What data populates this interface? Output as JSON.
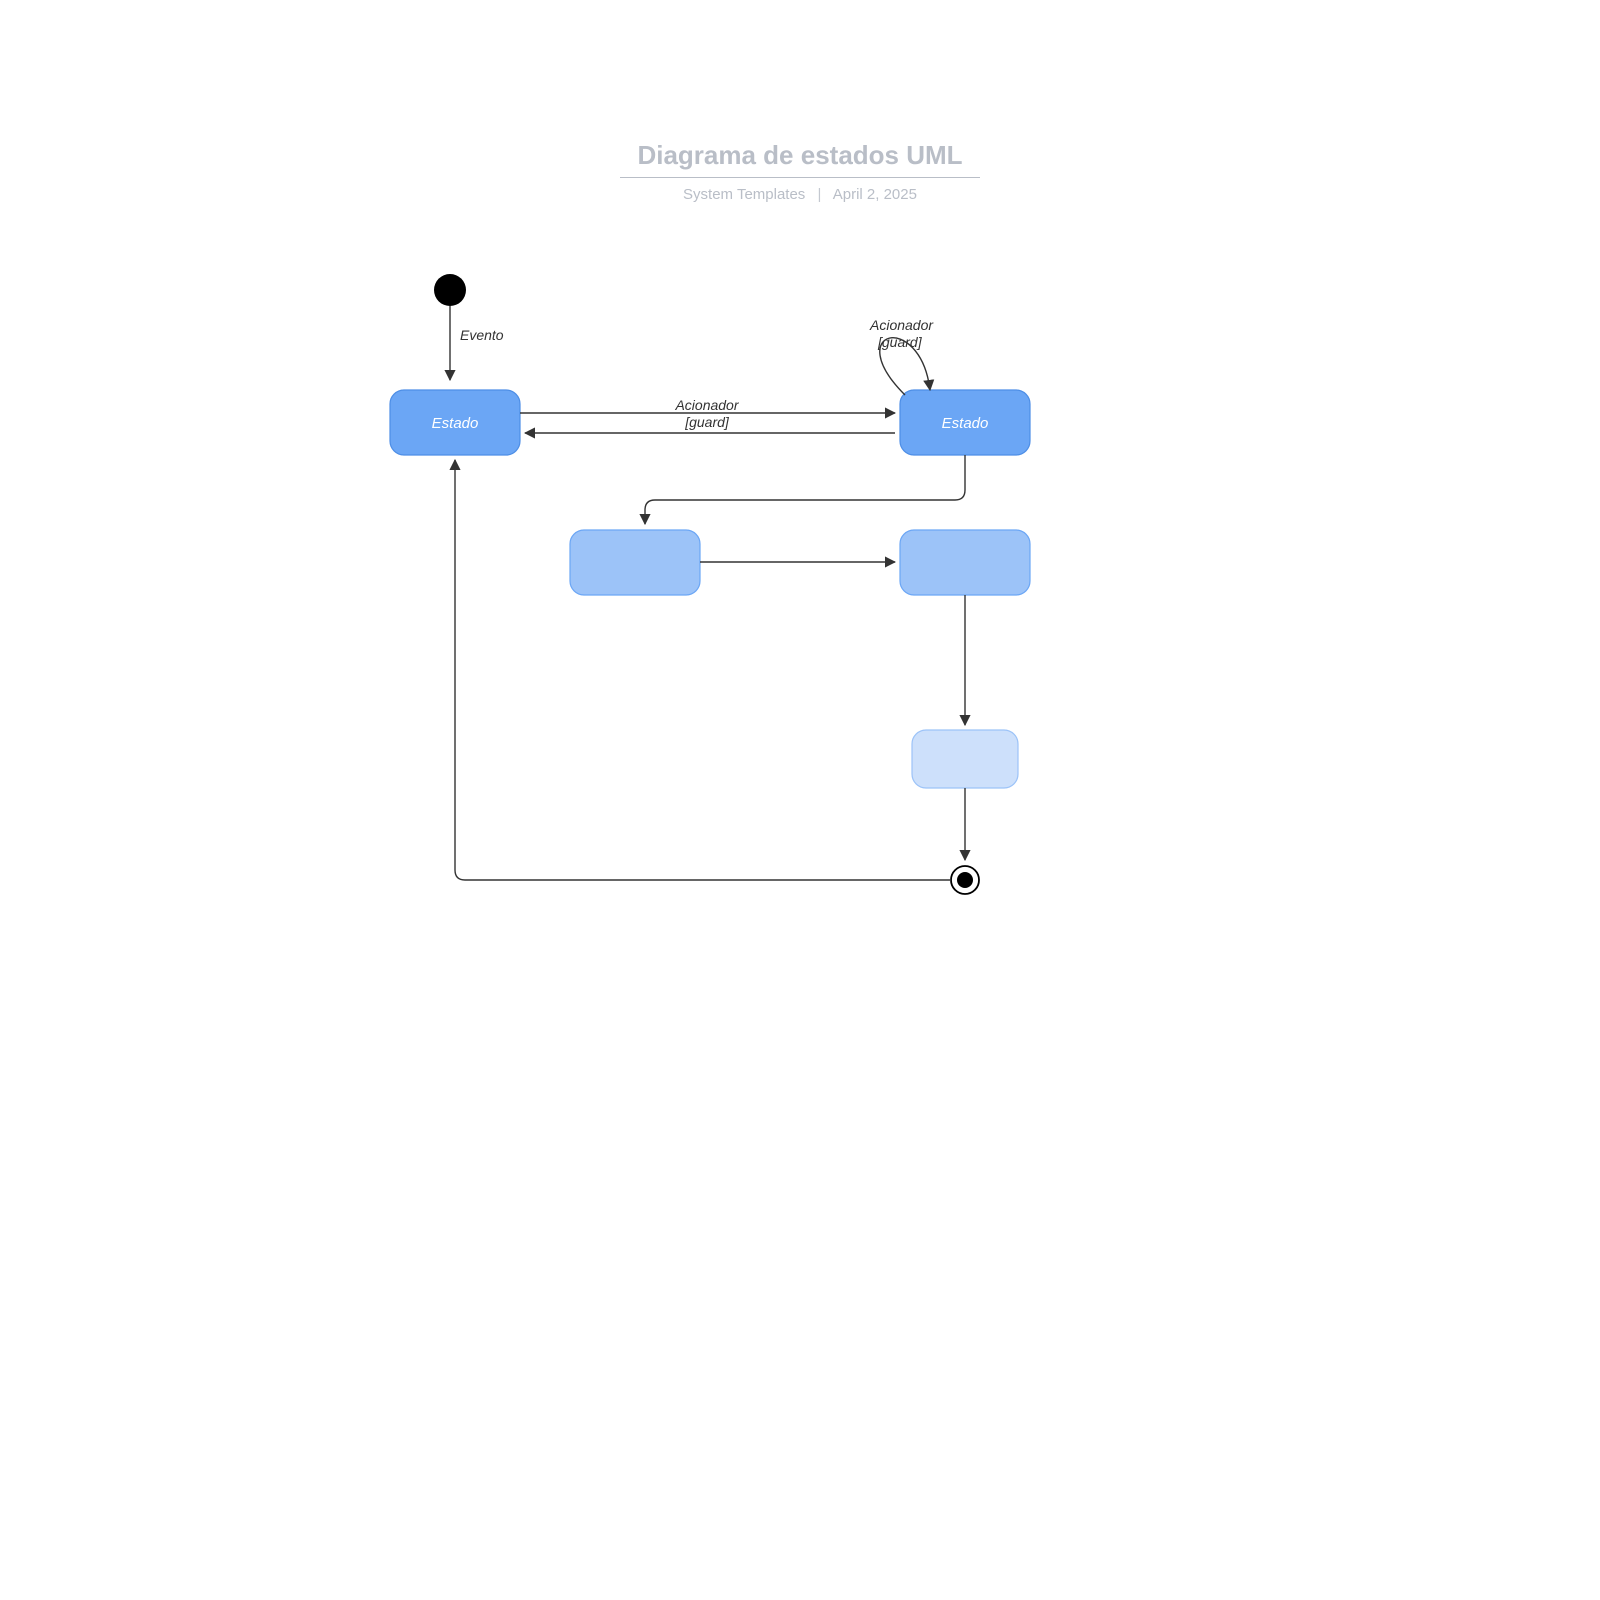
{
  "header": {
    "title": "Diagrama de estados UML",
    "source": "System Templates",
    "date": "April 2, 2025"
  },
  "states": {
    "s1": {
      "label": "Estado"
    },
    "s2": {
      "label": "Estado"
    },
    "s3": {
      "label": ""
    },
    "s4": {
      "label": ""
    },
    "s5": {
      "label": ""
    }
  },
  "edges": {
    "init_event": {
      "label": "Evento"
    },
    "self_loop": {
      "line1": "Acionador",
      "line2": "[guard]"
    },
    "s1_to_s2": {
      "line1": "Acionador",
      "line2": "[guard]"
    }
  },
  "colors": {
    "state_dark": "#6ba6f5",
    "state_mid": "#9cc3f8",
    "state_light": "#cde0fb",
    "stroke": "#4d8ee6"
  }
}
